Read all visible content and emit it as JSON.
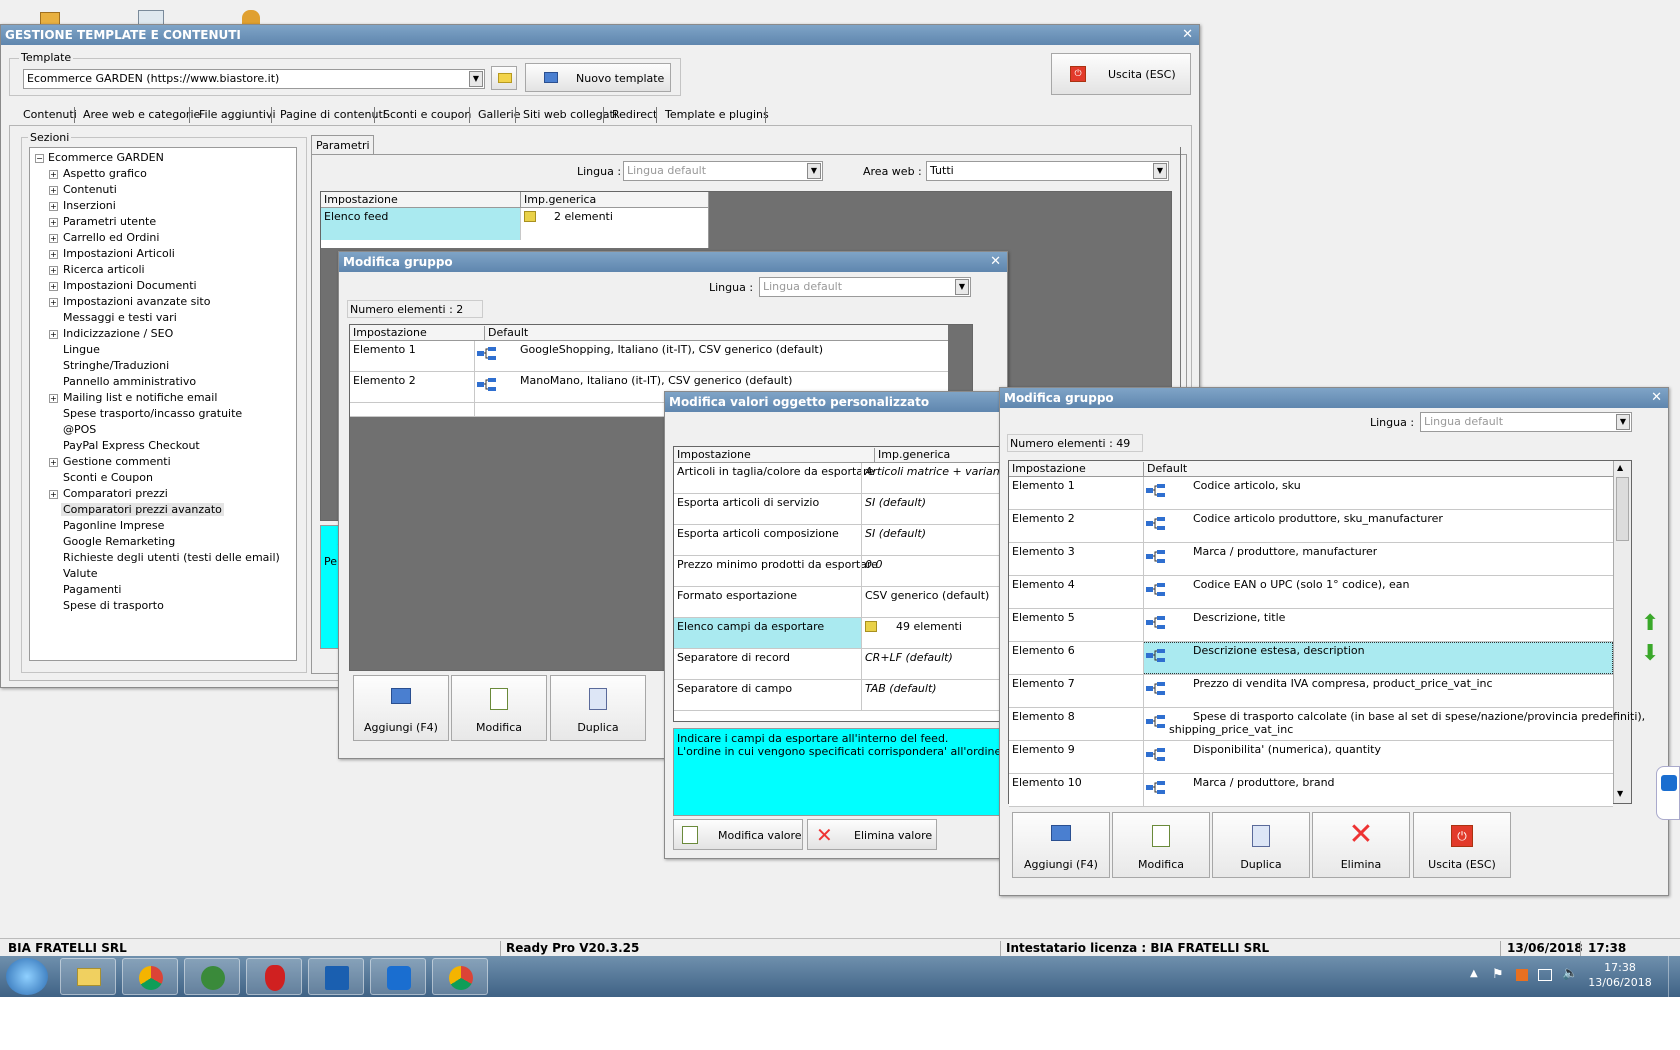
{
  "main_window": {
    "title": "GESTIONE TEMPLATE E CONTENUTI",
    "template_label": "Template",
    "template_value": "Ecommerce GARDEN (https://www.biastore.it)",
    "new_template_label": "Nuovo template",
    "exit_label": "Uscita (ESC)",
    "tabs": [
      "Contenuti",
      "Aree web e categorie",
      "File aggiuntivi",
      "Pagine di contenuti",
      "Sconti e coupon",
      "Gallerie",
      "Siti web collegati",
      "Redirect",
      "Template e plugins"
    ],
    "sections_label": "Sezioni",
    "tree_root": "Ecommerce GARDEN",
    "tree_items": [
      {
        "label": "Aspetto grafico",
        "expand": true
      },
      {
        "label": "Contenuti",
        "expand": true
      },
      {
        "label": "Inserzioni",
        "expand": true
      },
      {
        "label": "Parametri utente",
        "expand": true
      },
      {
        "label": "Carrello ed Ordini",
        "expand": true
      },
      {
        "label": "Impostazioni Articoli",
        "expand": true
      },
      {
        "label": "Ricerca articoli",
        "expand": true
      },
      {
        "label": "Impostazioni Documenti",
        "expand": true
      },
      {
        "label": "Impostazioni avanzate sito",
        "expand": true
      },
      {
        "label": "Messaggi e testi vari",
        "expand": false
      },
      {
        "label": "Indicizzazione / SEO",
        "expand": true
      },
      {
        "label": "Lingue",
        "expand": false
      },
      {
        "label": "Stringhe/Traduzioni",
        "expand": false
      },
      {
        "label": "Pannello amministrativo",
        "expand": false
      },
      {
        "label": "Mailing list e notifiche email",
        "expand": true
      },
      {
        "label": "Spese trasporto/incasso gratuite",
        "expand": false
      },
      {
        "label": "@POS",
        "expand": false
      },
      {
        "label": "PayPal Express Checkout",
        "expand": false
      },
      {
        "label": "Gestione commenti",
        "expand": true
      },
      {
        "label": "Sconti e Coupon",
        "expand": false
      },
      {
        "label": "Comparatori prezzi",
        "expand": true
      },
      {
        "label": "Comparatori prezzi avanzato",
        "expand": false
      },
      {
        "label": "Pagonline Imprese",
        "expand": false
      },
      {
        "label": "Google Remarketing",
        "expand": false
      },
      {
        "label": "Richieste degli utenti (testi delle email)",
        "expand": false
      },
      {
        "label": "Valute",
        "expand": false
      },
      {
        "label": "Pagamenti",
        "expand": false
      },
      {
        "label": "Spese di trasporto",
        "expand": false
      }
    ],
    "params_tab": "Parametri",
    "lingua_label": "Lingua :",
    "lingua_value": "Lingua default",
    "area_web_label": "Area web :",
    "area_web_value": "Tutti",
    "grid_col1": "Impostazione",
    "grid_col2": "Imp.generica",
    "grid_row_label": "Elenco feed",
    "grid_row_value": "2 elementi",
    "help_partial": "Tra\nPer"
  },
  "group1": {
    "title": "Modifica gruppo",
    "lingua_label": "Lingua :",
    "lingua_value": "Lingua default",
    "count": "Numero elementi : 2",
    "col1": "Impostazione",
    "col2": "Default",
    "rows": [
      {
        "name": "Elemento 1",
        "value": "GoogleShopping, Italiano (it-IT), CSV generico (default)"
      },
      {
        "name": "Elemento 2",
        "value": "ManoMano, Italiano (it-IT), CSV generico (default)"
      }
    ],
    "buttons": [
      "Aggiungi (F4)",
      "Modifica",
      "Duplica"
    ]
  },
  "custom_values": {
    "title": "Modifica valori oggetto personalizzato",
    "col1": "Impostazione",
    "col2": "Imp.generica",
    "rows": [
      {
        "name": "Articoli in taglia/colore da esportare",
        "value": "Articoli matrice + varianti",
        "italic": true
      },
      {
        "name": "Esporta articoli di servizio",
        "value": "SI (default)",
        "italic": true
      },
      {
        "name": "Esporta articoli composizione",
        "value": "SI (default)",
        "italic": true
      },
      {
        "name": "Prezzo minimo prodotti da esportare",
        "value": "0.0",
        "italic": true
      },
      {
        "name": "Formato esportazione",
        "value": "CSV generico (default)",
        "italic": false
      },
      {
        "name": "Elenco campi da esportare",
        "value": "49 elementi",
        "italic": false
      },
      {
        "name": "Separatore di record",
        "value": "CR+LF (default)",
        "italic": true
      },
      {
        "name": "Separatore di campo",
        "value": "TAB (default)",
        "italic": true
      }
    ],
    "help_line1": "Indicare i campi da esportare all'interno del feed.",
    "help_line2": "L'ordine in cui vengono specificati corrispondera' all'ordine in cui verr",
    "edit_label": "Modifica valore",
    "delete_label": "Elimina valore"
  },
  "group2": {
    "title": "Modifica gruppo",
    "lingua_label": "Lingua :",
    "lingua_value": "Lingua default",
    "count": "Numero elementi : 49",
    "col1": "Impostazione",
    "col2": "Default",
    "rows": [
      {
        "name": "Elemento 1",
        "value": "Codice articolo, sku"
      },
      {
        "name": "Elemento 2",
        "value": "Codice articolo produttore, sku_manufacturer"
      },
      {
        "name": "Elemento 3",
        "value": "Marca / produttore, manufacturer"
      },
      {
        "name": "Elemento 4",
        "value": "Codice EAN o UPC (solo 1° codice), ean"
      },
      {
        "name": "Elemento 5",
        "value": "Descrizione, title"
      },
      {
        "name": "Elemento 6",
        "value": "Descrizione estesa, description"
      },
      {
        "name": "Elemento 7",
        "value": "Prezzo di vendita IVA compresa, product_price_vat_inc"
      },
      {
        "name": "Elemento 8",
        "value": "Spese di trasporto calcolate (in base al set di spese/nazione/provincia predefiniti),",
        "value2": "shipping_price_vat_inc"
      },
      {
        "name": "Elemento 9",
        "value": "Disponibilita' (numerica), quantity"
      },
      {
        "name": "Elemento 10",
        "value": "Marca / produttore, brand"
      }
    ],
    "buttons": [
      "Aggiungi (F4)",
      "Modifica",
      "Duplica",
      "Elimina",
      "Uscita (ESC)"
    ]
  },
  "status_bar": {
    "company": "BIA FRATELLI SRL",
    "version": "Ready Pro V20.3.25",
    "license": "Intestatario licenza : BIA FRATELLI SRL",
    "date": "13/06/2018",
    "time": "17:38"
  },
  "taskbar": {
    "clock_time": "17:38",
    "clock_date": "13/06/2018"
  }
}
